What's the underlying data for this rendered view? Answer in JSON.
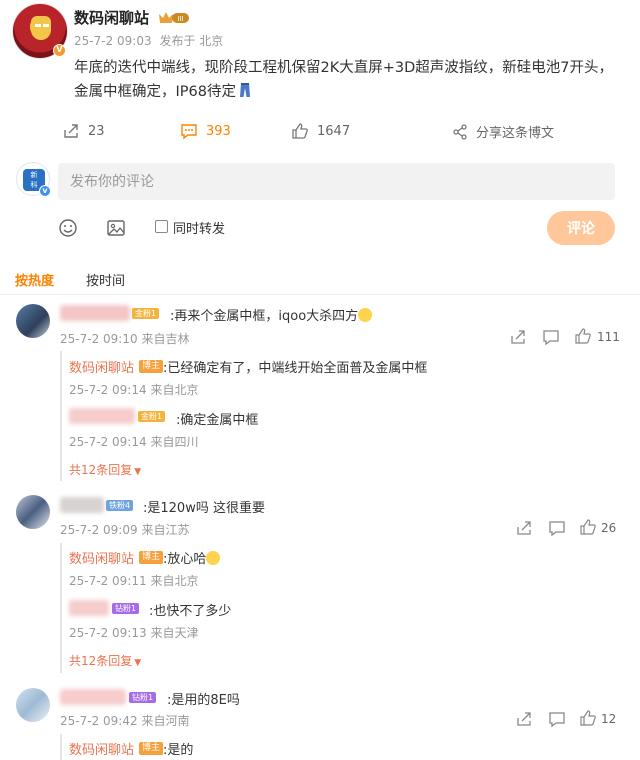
{
  "post": {
    "author": "数码闲聊站",
    "date": "25-7-2 09:03",
    "location": "发布于 北京",
    "text": "年底的迭代中端线，现阶段工程机保留2K大直屏+3D超声波指纹，新硅电池7开头，金属中框确定，IP68待定",
    "reposts": "23",
    "comments": "393",
    "likes": "1647",
    "share": "分享这条博文",
    "level_badge": "III"
  },
  "composer": {
    "placeholder": "发布你的评论",
    "repost_label": "同时转发",
    "submit": "评论"
  },
  "sort": {
    "hot": "按热度",
    "time": "按时间"
  },
  "comments": [
    {
      "badge": "金粉1",
      "text": ":再来个金属中框，iqoo大杀四方",
      "time": "25-7-2 09:10",
      "loc": "来自吉林",
      "likes": "111",
      "replies": [
        {
          "name": "数码闲聊站",
          "tag": "博主",
          "text": ":已经确定有了，中端线开始全面普及金属中框",
          "time": "25-7-2 09:14",
          "loc": "来自北京"
        },
        {
          "badge": "金粉1",
          "text": ":确定金属中框",
          "time": "25-7-2 09:14",
          "loc": "来自四川"
        }
      ],
      "more": "共12条回复"
    },
    {
      "badge": "铁粉4",
      "text": ":是120w吗 这很重要",
      "time": "25-7-2 09:09",
      "loc": "来自江苏",
      "likes": "26",
      "replies": [
        {
          "name": "数码闲聊站",
          "tag": "博主",
          "text": ":放心哈",
          "time": "25-7-2 09:11",
          "loc": "来自北京"
        },
        {
          "badge": "钻粉1",
          "text": ":也快不了多少",
          "time": "25-7-2 09:13",
          "loc": "来自天津"
        }
      ],
      "more": "共12条回复"
    },
    {
      "badge": "钻粉1",
      "text": ":是用的8E吗",
      "time": "25-7-2 09:42",
      "loc": "来自河南",
      "likes": "12",
      "replies": [
        {
          "name": "数码闲聊站",
          "tag": "博主",
          "text": ":是的"
        }
      ]
    }
  ],
  "icons": {
    "post_actions": [
      "share-icon",
      "comment-icon",
      "like-icon",
      "forward-icon"
    ],
    "comment_actions": [
      "share-icon",
      "reply-icon",
      "like-icon"
    ],
    "composer_tools": [
      "emoji-icon",
      "image-icon"
    ]
  },
  "colors": {
    "accent": "#ff8200",
    "reply_name": "#eb7350",
    "submit_bg": "#ffc79a",
    "blogger_tag": "#f3a13c"
  }
}
